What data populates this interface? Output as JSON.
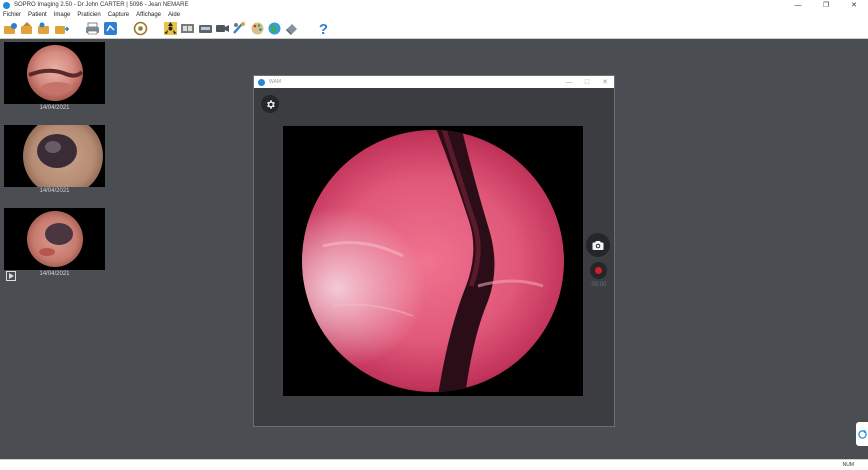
{
  "window": {
    "title": "SOPRO Imaging 2.50 - Dr John CARTER | 5096 - Jean NEMARE",
    "controls": [
      "minimize",
      "restore",
      "close"
    ]
  },
  "menu": {
    "items": [
      "Fichier",
      "Patient",
      "Image",
      "Praticien",
      "Capture",
      "Affichage",
      "Aide"
    ]
  },
  "toolbar": {
    "icons": [
      "open-patient-icon",
      "new-patient-icon",
      "patient-list-icon",
      "add-patient-icon",
      "print-icon",
      "export-icon",
      "camera-settings-icon",
      "xray-icon",
      "film-strip-icon",
      "scanner-icon",
      "video-camera-icon",
      "intraoral-camera-icon",
      "palette-icon",
      "globe-icon",
      "save-icon",
      "help-icon"
    ],
    "help_label": "?"
  },
  "thumbnails": [
    {
      "date": "14/04/2021",
      "kind": "photo"
    },
    {
      "date": "14/04/2021",
      "kind": "photo"
    },
    {
      "date": "14/04/2021",
      "kind": "video"
    }
  ],
  "viewer": {
    "title": "WAM",
    "controls": [
      "minimize",
      "maximize",
      "close"
    ],
    "record_time": "00:00",
    "accent_record": "#d01f26"
  },
  "statusbar": {
    "num_lock": "NUM"
  }
}
